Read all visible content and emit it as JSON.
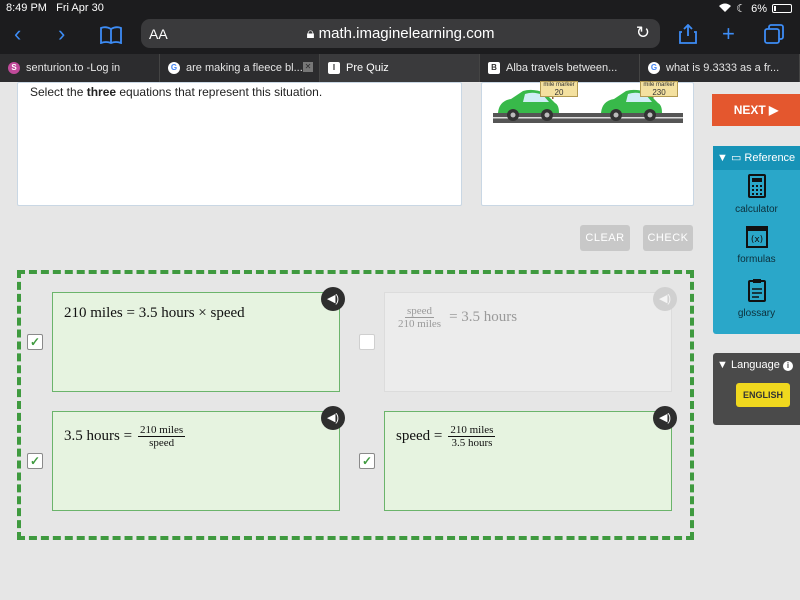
{
  "status_bar": {
    "time": "8:49 PM",
    "date": "Fri Apr 30",
    "battery": "6%"
  },
  "browser": {
    "aa_label": "AA",
    "url": "math.imaginelearning.com",
    "tabs": [
      {
        "label": "senturion.to -Log in",
        "favicon": "s-icon",
        "color": "#c04a9a"
      },
      {
        "label": "are making a fleece bl...",
        "favicon": "google-icon",
        "color": "#ffffff"
      },
      {
        "label": "Pre Quiz",
        "favicon": "i-icon",
        "color": "#ffffff",
        "active": true
      },
      {
        "label": "Alba travels between...",
        "favicon": "b-icon",
        "color": "#ffffff"
      },
      {
        "label": "what is 9.3333 as a fr...",
        "favicon": "google-icon",
        "color": "#ffffff"
      }
    ]
  },
  "question": {
    "instruction_pre": "Select the ",
    "instruction_bold": "three",
    "instruction_post": " equations that represent this situation.",
    "markers": [
      {
        "label": "mile marker",
        "value": "20"
      },
      {
        "label": "mile marker",
        "value": "230"
      }
    ]
  },
  "controls": {
    "clear_label": "CLEAR",
    "check_label": "CHECK"
  },
  "options": [
    {
      "id": "a",
      "checked": true,
      "selectable": true,
      "text": "210 miles = 3.5 hours × speed"
    },
    {
      "id": "b",
      "checked": false,
      "selectable": false,
      "num": "speed",
      "den": "210  miles",
      "rhs": "= 3.5  hours"
    },
    {
      "id": "c",
      "checked": true,
      "selectable": true,
      "lhs": "3.5 hours =",
      "num": "210  miles",
      "den": "speed"
    },
    {
      "id": "d",
      "checked": true,
      "selectable": true,
      "lhs": "speed =",
      "num": "210  miles",
      "den": "3.5  hours"
    }
  ],
  "sidebar": {
    "next_label": "NEXT ▶",
    "reference_label": "Reference",
    "tools": [
      {
        "label": "calculator",
        "icon": "calculator-icon"
      },
      {
        "label": "formulas",
        "icon": "formulas-icon"
      },
      {
        "label": "glossary",
        "icon": "glossary-icon"
      }
    ],
    "language_label": "Language",
    "language_value": "ENGLISH"
  },
  "colors": {
    "accent": "#e4572e",
    "correct_green": "#3f9a3f",
    "reference_teal": "#2aa7c9",
    "language_yellow": "#f0d81e"
  }
}
